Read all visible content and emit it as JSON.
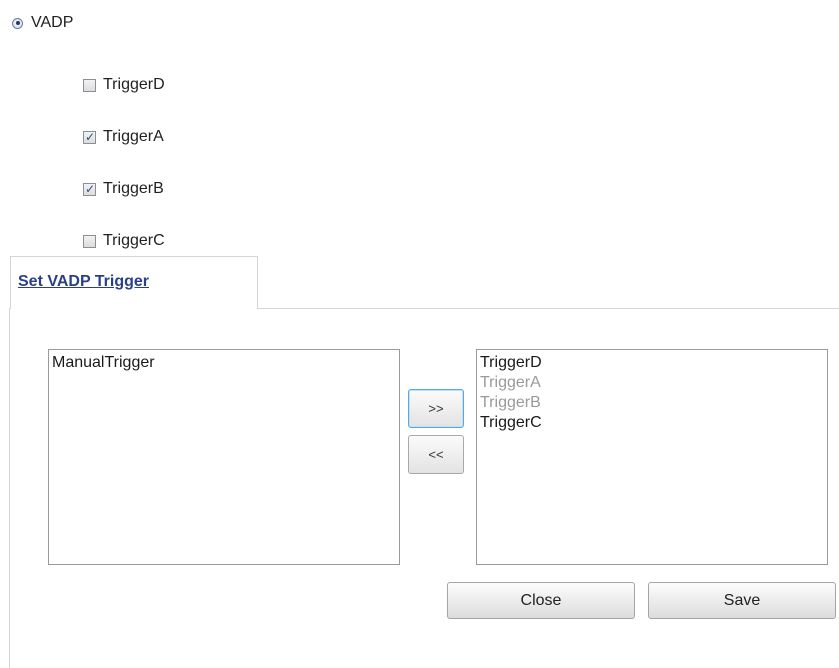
{
  "vadp_option": {
    "label": "VADP",
    "selected": true
  },
  "triggers": [
    {
      "label": "TriggerD",
      "checked": false
    },
    {
      "label": "TriggerA",
      "checked": true
    },
    {
      "label": "TriggerB",
      "checked": true
    },
    {
      "label": "TriggerC",
      "checked": false
    }
  ],
  "tab": {
    "label": "Set VADP Trigger"
  },
  "available_list": {
    "items": [
      {
        "label": "ManualTrigger",
        "disabled": false
      }
    ]
  },
  "selected_list": {
    "items": [
      {
        "label": "TriggerD",
        "disabled": false
      },
      {
        "label": "TriggerA",
        "disabled": true
      },
      {
        "label": "TriggerB",
        "disabled": true
      },
      {
        "label": "TriggerC",
        "disabled": false
      }
    ]
  },
  "move_buttons": {
    "add_label": ">>",
    "remove_label": "<<"
  },
  "actions": {
    "close_label": "Close",
    "save_label": "Save"
  },
  "icons": {
    "checkmark": "checkmark-icon",
    "radio_dot": "radio-selected-icon"
  },
  "colors": {
    "tab_link": "#2a3f8c",
    "disabled_text": "#9a9a9a",
    "focus_border": "#5da7dc"
  }
}
